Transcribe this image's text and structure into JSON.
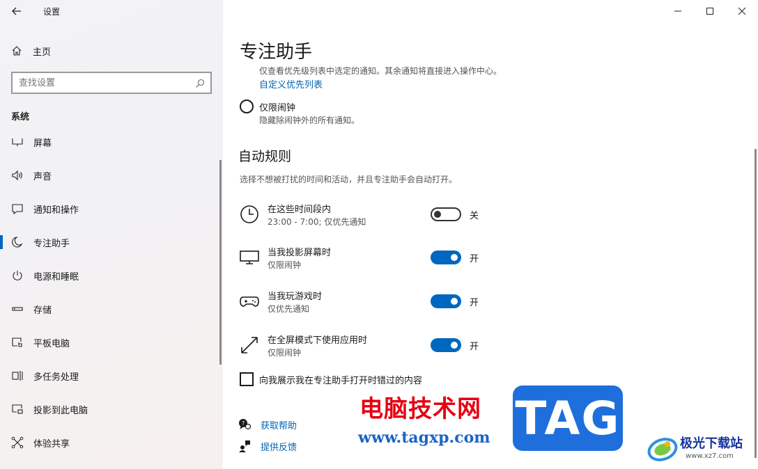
{
  "window": {
    "title": "设置"
  },
  "sidebar": {
    "home_label": "主页",
    "search_placeholder": "查找设置",
    "section_label": "系统",
    "items": [
      {
        "label": "屏幕",
        "icon": "display-icon"
      },
      {
        "label": "声音",
        "icon": "speaker-icon"
      },
      {
        "label": "通知和操作",
        "icon": "notification-icon"
      },
      {
        "label": "专注助手",
        "icon": "moon-icon",
        "active": true
      },
      {
        "label": "电源和睡眠",
        "icon": "power-icon"
      },
      {
        "label": "存储",
        "icon": "storage-icon"
      },
      {
        "label": "平板电脑",
        "icon": "tablet-icon"
      },
      {
        "label": "多任务处理",
        "icon": "multitask-icon"
      },
      {
        "label": "投影到此电脑",
        "icon": "project-icon"
      },
      {
        "label": "体验共享",
        "icon": "share-icon"
      }
    ]
  },
  "main": {
    "page_title": "专注助手",
    "priority_desc": "仅查看优先级列表中选定的通知。其余通知将直接进入操作中心。",
    "priority_link": "自定义优先列表",
    "alarms_only": {
      "label": "仅限闹钟",
      "desc": "隐藏除闹钟外的所有通知。"
    },
    "auto_rules": {
      "title": "自动规则",
      "desc": "选择不想被打扰的时间和活动，并且专注助手会自动打开。",
      "rules": [
        {
          "name": "在这些时间段内",
          "sub": "23:00 - 7:00; 仅优先通知",
          "state": "关",
          "on": false,
          "icon": "clock-icon"
        },
        {
          "name": "当我投影屏幕时",
          "sub": "仅限闹钟",
          "state": "开",
          "on": true,
          "icon": "monitor-icon"
        },
        {
          "name": "当我玩游戏时",
          "sub": "仅优先通知",
          "state": "开",
          "on": true,
          "icon": "gamepad-icon"
        },
        {
          "name": "在全屏模式下使用应用时",
          "sub": "仅限闹钟",
          "state": "开",
          "on": true,
          "icon": "fullscreen-icon"
        }
      ]
    },
    "checkbox_label": "向我展示我在专注助手打开时错过的内容",
    "help": {
      "get_help": "获取帮助",
      "feedback": "提供反馈"
    }
  },
  "watermark": {
    "cn_text": "电脑技术网",
    "url": "www.tagxp.com",
    "tag": "TAG",
    "site_name": "极光下载站",
    "site_url": "www.xz7.com"
  },
  "colors": {
    "accent": "#0067c0",
    "link": "#0063b1",
    "watermark_red": "#e60012",
    "watermark_blue": "#1e6fdc"
  }
}
